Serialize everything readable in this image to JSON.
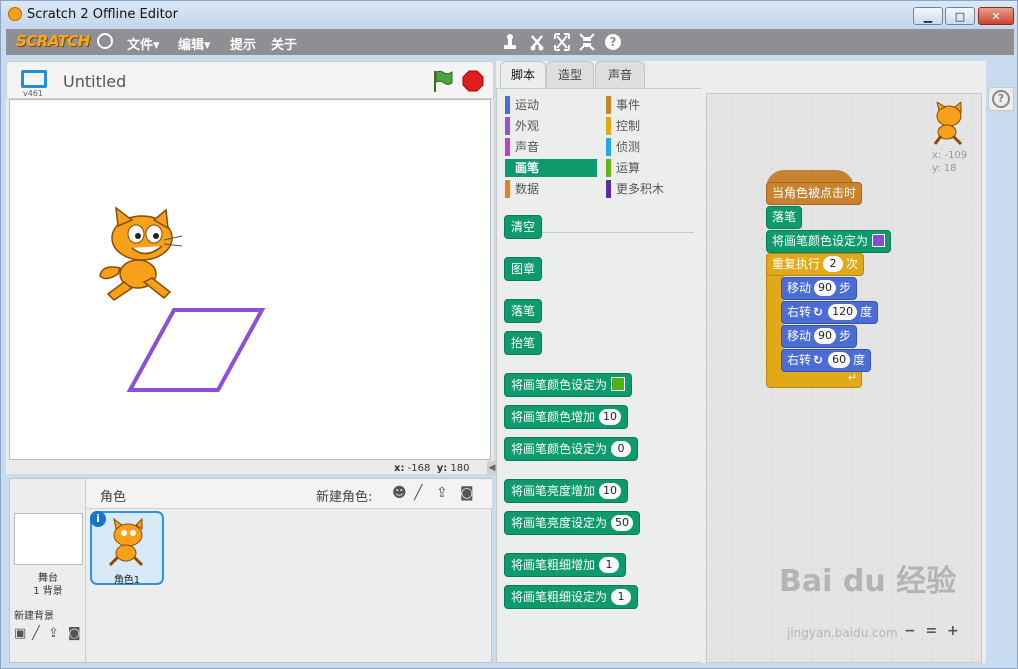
{
  "window": {
    "title": "Scratch 2 Offline Editor",
    "min": "▁",
    "max": "□",
    "close": "✕"
  },
  "menubar": {
    "logo": "SCRATCH",
    "items": [
      "文件▾",
      "编辑▾",
      "提示",
      "关于"
    ],
    "tools": [
      "duplicate-icon",
      "delete-icon",
      "grow-icon",
      "shrink-icon",
      "help-icon"
    ]
  },
  "stage": {
    "version": "v461",
    "project_title": "Untitled",
    "x_label": "x:",
    "x_value": "-168",
    "y_label": "y:",
    "y_value": "180",
    "pen_color": "#8c4fd6"
  },
  "sprites": {
    "section_label": "角色",
    "new_sprite_label": "新建角色:",
    "stage_label": "舞台",
    "stage_backdrop_count": "1 背景",
    "new_backdrop_label": "新建背景",
    "sprite_name": "角色1",
    "info": "i"
  },
  "editor": {
    "tabs": [
      "脚本",
      "造型",
      "声音"
    ],
    "categories_left": [
      {
        "label": "运动",
        "color": "#4a6cd4"
      },
      {
        "label": "外观",
        "color": "#8a55d7"
      },
      {
        "label": "声音",
        "color": "#bb42c3"
      },
      {
        "label": "画笔",
        "color": "#0e9a6c"
      },
      {
        "label": "数据",
        "color": "#ee7d16"
      }
    ],
    "categories_right": [
      {
        "label": "事件",
        "color": "#c88330"
      },
      {
        "label": "控制",
        "color": "#e1a91a"
      },
      {
        "label": "侦测",
        "color": "#2ca5e2"
      },
      {
        "label": "运算",
        "color": "#5cb712"
      },
      {
        "label": "更多积木",
        "color": "#632d99"
      }
    ],
    "active_category": "画笔",
    "pen_blocks": {
      "clear": "清空",
      "stamp": "图章",
      "pen_down": "落笔",
      "pen_up": "抬笔",
      "set_color": "将画笔颜色设定为",
      "set_color_swatch": "#4bb21a",
      "change_color": "将画笔颜色增加",
      "change_color_value": "10",
      "set_shade_color": "将画笔颜色设定为",
      "set_shade_color_value": "0",
      "change_shade": "将画笔亮度增加",
      "change_shade_value": "10",
      "set_shade": "将画笔亮度设定为",
      "set_shade_value": "50",
      "change_size": "将画笔粗细增加",
      "change_size_value": "1",
      "set_size": "将画笔粗细设定为",
      "set_size_value": "1"
    },
    "sprite_x": "x: -109",
    "sprite_y": "y: 18",
    "script": {
      "hat": "当角色被点击时",
      "pen_down": "落笔",
      "set_color": "将画笔颜色设定为",
      "set_color_swatch": "#7f4fd6",
      "repeat": "重复执行",
      "repeat_times": "2",
      "repeat_unit": "次",
      "move1": "移动",
      "move1_value": "90",
      "move1_unit": "步",
      "turn1": "右转",
      "turn1_value": "120",
      "turn1_unit": "度",
      "move2": "移动",
      "move2_value": "90",
      "move2_unit": "步",
      "turn2": "右转",
      "turn2_value": "60",
      "turn2_unit": "度"
    },
    "zoom": [
      "−",
      "=",
      "+"
    ]
  },
  "watermark": {
    "logo": "Bai du 经验",
    "url": "jingyan.baidu.com"
  }
}
